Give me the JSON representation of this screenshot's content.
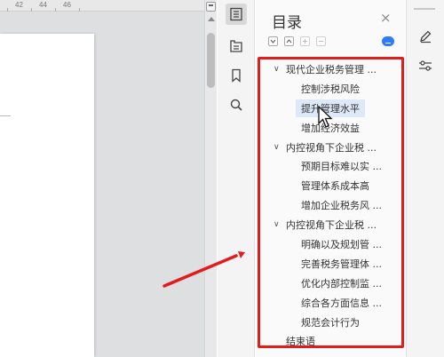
{
  "ruler": {
    "numbers": [
      "42",
      "44",
      "46"
    ]
  },
  "toc": {
    "title": "目录",
    "close_label": "×",
    "items": [
      {
        "level": 1,
        "expanded": true,
        "text": "现代企业税务管理 ..."
      },
      {
        "level": 2,
        "text": "控制涉税风险"
      },
      {
        "level": 2,
        "text": "提升管理水平",
        "selected": true
      },
      {
        "level": 2,
        "text": "增加经济效益"
      },
      {
        "level": 1,
        "expanded": true,
        "text": "内控视角下企业税 ..."
      },
      {
        "level": 2,
        "text": "预期目标难以实 ..."
      },
      {
        "level": 2,
        "text": "管理体系成本高"
      },
      {
        "level": 2,
        "text": "增加企业税务风 ..."
      },
      {
        "level": 1,
        "expanded": true,
        "text": "内控视角下企业税 ..."
      },
      {
        "level": 2,
        "text": "明确以及规划管 ..."
      },
      {
        "level": 2,
        "text": "完善税务管理体 ..."
      },
      {
        "level": 2,
        "text": "优化内部控制监 ..."
      },
      {
        "level": 2,
        "text": "综合各方面信息 ..."
      },
      {
        "level": 2,
        "text": "规范会计行为"
      },
      {
        "level": 0,
        "text": "结束语"
      }
    ]
  },
  "colors": {
    "annotation_red": "#e01c1c",
    "selection_bg": "#dde9f8",
    "accent_blue": "#2f7cf6"
  },
  "icons": {
    "toolbar": [
      "toc-icon",
      "navigation-pane-icon",
      "bookmark-icon",
      "search-icon"
    ],
    "mini_tools": [
      "expand-all-icon",
      "collapse-all-icon",
      "add-heading-icon",
      "remove-heading-icon",
      "cloud-sync-icon"
    ],
    "right_toolbar": [
      "pen-icon",
      "settings-sliders-icon"
    ]
  }
}
